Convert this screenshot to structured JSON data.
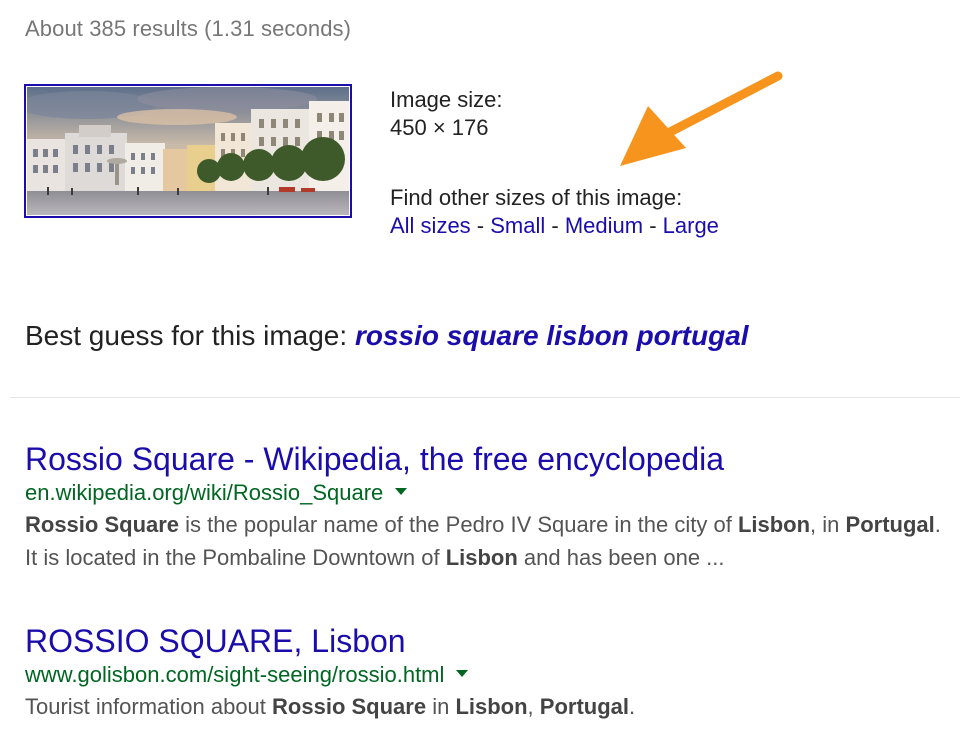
{
  "stats": "About 385 results (1.31 seconds)",
  "thumbnail": {
    "alt_icon": "rossio-square-photo"
  },
  "info": {
    "image_size_label": "Image size:",
    "image_size_value": "450 × 176",
    "other_sizes_label": "Find other sizes of this image:",
    "links": [
      "All sizes",
      "Small",
      "Medium",
      "Large"
    ],
    "separator": " - "
  },
  "annotation": {
    "arrow_color": "#f7941d"
  },
  "best_guess": {
    "label": "Best guess for this image: ",
    "query": "rossio square lisbon portugal"
  },
  "results": [
    {
      "title": "Rossio Square - Wikipedia, the free encyclopedia",
      "url": "en.wikipedia.org/wiki/Rossio_Square",
      "snippet": [
        {
          "t": "Rossio Square",
          "b": true
        },
        {
          "t": " is the popular name of the Pedro IV Square in the city of ",
          "b": false
        },
        {
          "t": "Lisbon",
          "b": true
        },
        {
          "t": ", in ",
          "b": false
        },
        {
          "t": "Portugal",
          "b": true
        },
        {
          "t": ". It is located in the Pombaline Downtown of ",
          "b": false
        },
        {
          "t": "Lisbon",
          "b": true
        },
        {
          "t": " and has been one  ...",
          "b": false
        }
      ]
    },
    {
      "title": "ROSSIO SQUARE, Lisbon",
      "url": "www.golisbon.com/sight-seeing/rossio.html",
      "snippet": [
        {
          "t": "Tourist information about ",
          "b": false
        },
        {
          "t": "Rossio Square",
          "b": true
        },
        {
          "t": " in ",
          "b": false
        },
        {
          "t": "Lisbon",
          "b": true
        },
        {
          "t": ", ",
          "b": false
        },
        {
          "t": "Portugal",
          "b": true
        },
        {
          "t": ".",
          "b": false
        }
      ]
    }
  ],
  "colors": {
    "link": "#1a0dab",
    "url": "#006621",
    "snippet": "#545454",
    "stats": "#777777"
  }
}
